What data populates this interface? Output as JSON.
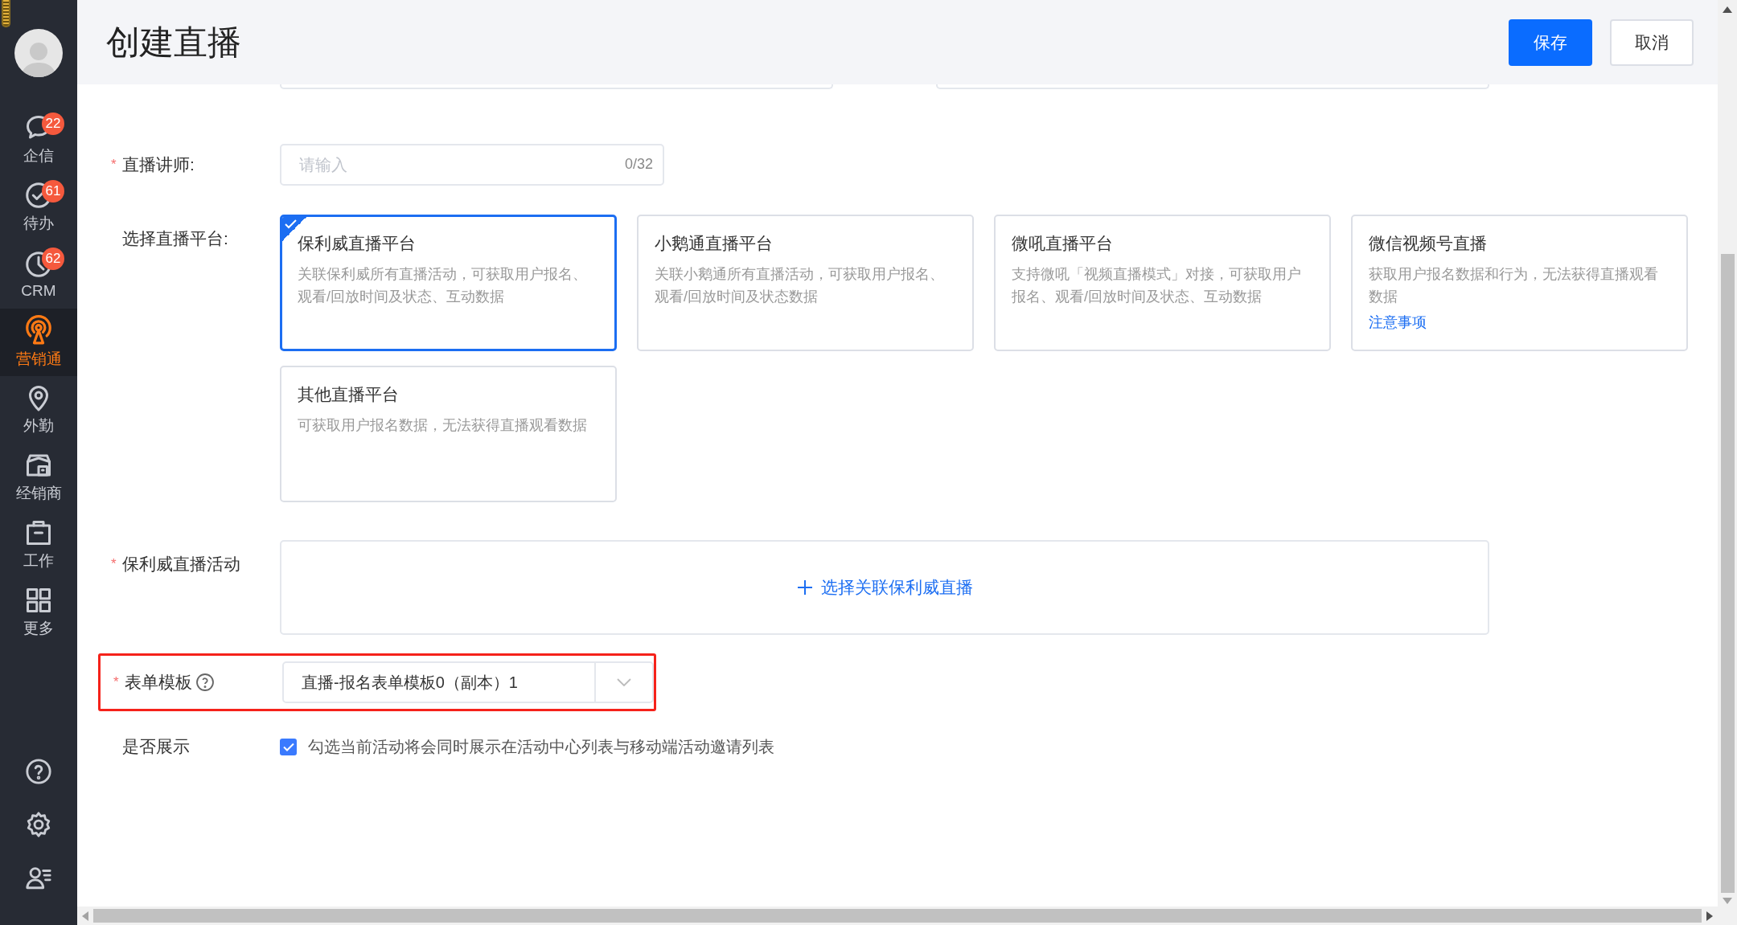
{
  "sidebar": {
    "items": [
      {
        "label": "企信",
        "badge": "22",
        "selected": false
      },
      {
        "label": "待办",
        "badge": "61",
        "selected": false
      },
      {
        "label": "CRM",
        "badge": "62",
        "selected": false
      },
      {
        "label": "营销通",
        "selected": true
      },
      {
        "label": "外勤",
        "selected": false
      },
      {
        "label": "经销商",
        "selected": false
      },
      {
        "label": "工作",
        "selected": false
      },
      {
        "label": "更多",
        "selected": false
      }
    ]
  },
  "header": {
    "title": "创建直播",
    "buttons": [
      {
        "label": "保存",
        "kind": "primary"
      },
      {
        "label": "取消",
        "kind": "default"
      }
    ]
  },
  "form": {
    "lecturer": {
      "label": "直播讲师:",
      "required_mark": "*",
      "placeholder": "请输入",
      "counter": "0/32"
    },
    "platform": {
      "label": "选择直播平台:",
      "options": [
        {
          "title": "保利威直播平台",
          "description": "关联保利威所有直播活动，可获取用户报名、观看/回放时间及状态、互动数据",
          "selected": true
        },
        {
          "title": "小鹅通直播平台",
          "description": "关联小鹅通所有直播活动，可获取用户报名、观看/回放时间及状态数据",
          "selected": false
        },
        {
          "title": "微吼直播平台",
          "description": "支持微吼「视频直播模式」对接，可获取用户报名、观看/回放时间及状态、互动数据",
          "selected": false
        },
        {
          "title": "微信视频号直播",
          "description": "获取用户报名数据和行为，无法获得直播观看数据",
          "link": "注意事项",
          "selected": false
        },
        {
          "title": "其他直播平台",
          "description": "可获取用户报名数据，无法获得直播观看数据",
          "selected": false
        }
      ]
    },
    "activity": {
      "label": "保利威直播活动",
      "required_mark": "*",
      "action": "选择关联保利威直播"
    },
    "template": {
      "label": "表单模板",
      "required_mark": "*",
      "value": "直播-报名表单模板0（副本）1",
      "highlighted": true
    },
    "display": {
      "label": "是否展示",
      "checked": true,
      "text": "勾选当前活动将会同时展示在活动中心列表与移动端活动邀请列表"
    }
  }
}
